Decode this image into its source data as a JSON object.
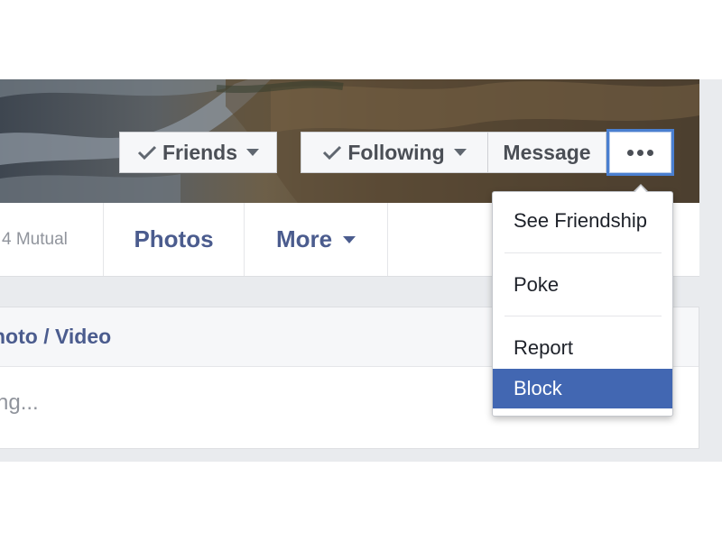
{
  "profile_actions": {
    "friends_label": "Friends",
    "following_label": "Following",
    "message_label": "Message"
  },
  "tabs": {
    "mutual_label": "4 Mutual",
    "photos_label": "Photos",
    "more_label": "More"
  },
  "composer": {
    "header_label": "hoto / Video",
    "input_placeholder": "ng..."
  },
  "more_menu": {
    "items": [
      {
        "label": "See Friendship"
      },
      {
        "label": "Poke"
      },
      {
        "label": "Report"
      },
      {
        "label": "Block",
        "highlighted": true
      }
    ]
  },
  "colors": {
    "accent_blue": "#4267b2",
    "link_blue": "#4b5c8e",
    "focus_outline": "#4a7fd0"
  },
  "icons": [
    "check-icon",
    "caret-down-icon",
    "more-dots-icon"
  ]
}
